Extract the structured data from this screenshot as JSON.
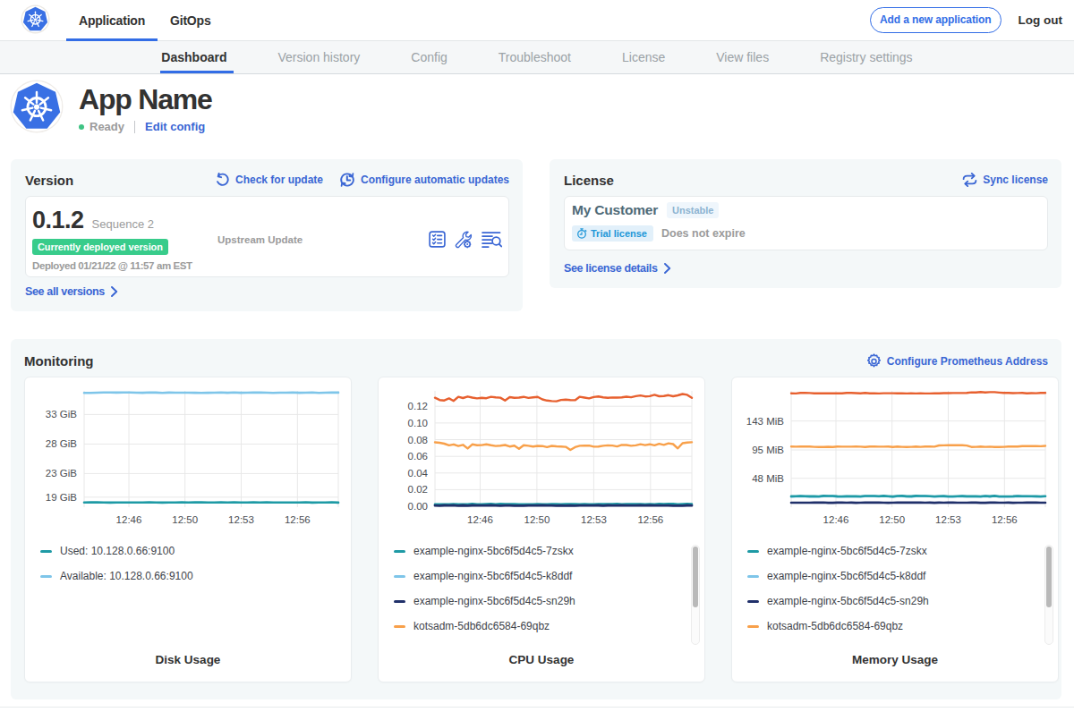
{
  "navbar": {
    "tabs": [
      "Application",
      "GitOps"
    ],
    "add_app_label": "Add a new application",
    "logout_label": "Log out"
  },
  "subnav": {
    "tabs": [
      "Dashboard",
      "Version history",
      "Config",
      "Troubleshoot",
      "License",
      "View files",
      "Registry settings"
    ],
    "active": "Dashboard"
  },
  "app": {
    "name": "App Name",
    "status": "Ready",
    "edit_config": "Edit config"
  },
  "version": {
    "title": "Version",
    "check_update": "Check for update",
    "auto_updates": "Configure automatic updates",
    "number": "0.1.2",
    "sequence": "Sequence 2",
    "deployed_badge": "Currently deployed version",
    "deployed_at": "Deployed 01/21/22 @ 11:57 am EST",
    "source": "Upstream Update",
    "see_all": "See all versions"
  },
  "license": {
    "title": "License",
    "sync": "Sync license",
    "customer": "My Customer",
    "channel": "Unstable",
    "type": "Trial license",
    "expiration": "Does not expire",
    "see_details": "See license details"
  },
  "monitoring": {
    "title": "Monitoring",
    "configure": "Configure Prometheus Address"
  },
  "colors": {
    "accent": "#326de6",
    "link": "#3a66d4",
    "green": "#38cc8b",
    "grid": "#e8e8e8",
    "teal": "#1e9aa5",
    "lightblue": "#7ec5e9",
    "navy": "#20306a",
    "orange": "#f8a04a",
    "redorange": "#e7602f"
  },
  "chart_data": [
    {
      "id": "disk",
      "type": "line",
      "title": "Disk Usage",
      "plot_left": 66,
      "x_ticks": [
        "12:46",
        "12:50",
        "12:53",
        "12:56"
      ],
      "x_tick_pos": [
        0.176,
        0.397,
        0.618,
        0.839
      ],
      "y_ticks": [
        {
          "label": "19 GiB",
          "value": 19
        },
        {
          "label": "23 GiB",
          "value": 23
        },
        {
          "label": "28 GiB",
          "value": 28
        },
        {
          "label": "33 GiB",
          "value": 33
        }
      ],
      "ylim": [
        17.3,
        37.0
      ],
      "scrollbar": false,
      "series": [
        {
          "name": "Used: 10.128.0.66:9100",
          "color": "teal",
          "width": 2.6,
          "values": [
            18.085,
            18.128,
            18.112,
            18.088,
            18.071,
            18.1,
            18.11,
            18.095,
            18.085,
            18.11,
            18.126,
            18.084,
            18.072,
            18.09,
            18.095,
            18.111,
            18.082,
            18.118,
            18.114,
            18.1,
            18.082,
            18.128,
            18.089,
            18.119,
            18.084,
            18.083,
            18.116,
            18.088,
            18.127,
            18.1,
            18.081,
            18.083,
            18.095,
            18.11,
            18.127,
            18.079,
            18.094,
            18.083,
            18.128,
            18.079
          ]
        },
        {
          "name": "Available: 10.128.0.66:9100",
          "color": "lightblue",
          "width": 2.6,
          "values": [
            36.673,
            36.674,
            36.694,
            36.724,
            36.723,
            36.714,
            36.73,
            36.726,
            36.69,
            36.681,
            36.726,
            36.715,
            36.672,
            36.71,
            36.693,
            36.692,
            36.69,
            36.68,
            36.67,
            36.687,
            36.691,
            36.727,
            36.677,
            36.728,
            36.682,
            36.691,
            36.719,
            36.719,
            36.696,
            36.673,
            36.698,
            36.692,
            36.725,
            36.682,
            36.692,
            36.724,
            36.672,
            36.695,
            36.719,
            36.716
          ]
        }
      ]
    },
    {
      "id": "cpu",
      "type": "line",
      "title": "CPU Usage",
      "plot_left": 63,
      "x_ticks": [
        "12:46",
        "12:50",
        "12:53",
        "12:56"
      ],
      "x_tick_pos": [
        0.176,
        0.397,
        0.618,
        0.839
      ],
      "y_ticks": [
        {
          "label": "0.00",
          "value": 0.0
        },
        {
          "label": "0.02",
          "value": 0.02
        },
        {
          "label": "0.04",
          "value": 0.04
        },
        {
          "label": "0.06",
          "value": 0.06
        },
        {
          "label": "0.08",
          "value": 0.08
        },
        {
          "label": "0.10",
          "value": 0.1
        },
        {
          "label": "0.12",
          "value": 0.12
        }
      ],
      "ylim": [
        -0.001,
        0.1385
      ],
      "scrollbar": true,
      "series": [
        {
          "name": "example-nginx-5bc6f5d4c5-7zskx",
          "color": "teal",
          "width": 2.6,
          "z": 2,
          "values": [
            0.00243,
            0.00245,
            0.00248,
            0.00244,
            0.00265,
            0.00246,
            0.00255,
            0.00238,
            0.00285,
            0.00251,
            0.00257,
            0.00265,
            0.00284,
            0.00255,
            0.00285,
            0.0026,
            0.00262,
            0.00261,
            0.00231,
            0.00256,
            0.00241,
            0.0023,
            0.00278,
            0.0024,
            0.00258,
            0.00274,
            0.00263,
            0.0025,
            0.00261,
            0.00263,
            0.00277,
            0.00236,
            0.00264,
            0.00245,
            0.00247,
            0.00276,
            0.0026,
            0.00264,
            0.00276,
            0.00285,
            0.00257,
            0.00267,
            0.0026,
            0.00261,
            0.00272,
            0.00257,
            0.00262,
            0.00259,
            0.00286,
            0.00272,
            0.00283,
            0.00287,
            0.00246,
            0.00264,
            0.00287,
            0.0028
          ]
        },
        {
          "name": "example-nginx-5bc6f5d4c5-k8ddf",
          "color": "lightblue",
          "width": 2.4,
          "z": 1,
          "values": [
            0.00165,
            0.00165,
            0.00178,
            0.00163,
            0.0017,
            0.00163,
            0.00187,
            0.00191,
            0.00196,
            0.00166,
            0.00189,
            0.00186,
            0.00166,
            0.00195,
            0.00199,
            0.00169,
            0.00198,
            0.00176,
            0.00179,
            0.002,
            0.00193,
            0.00166,
            0.00177,
            0.00181,
            0.00174,
            0.00168,
            0.00173,
            0.00189,
            0.00161,
            0.00182,
            0.00178,
            0.00161,
            0.00173,
            0.00185,
            0.0018,
            0.00163,
            0.00199,
            0.00192,
            0.00199,
            0.00164,
            0.00171,
            0.00162,
            0.00191,
            0.00171,
            0.00165,
            0.00177,
            0.00196,
            0.00193,
            0.0017,
            0.00166,
            0.00197,
            0.00183,
            0.00188,
            0.00164,
            0.00162,
            0.00188
          ]
        },
        {
          "name": "example-nginx-5bc6f5d4c5-sn29h",
          "color": "navy",
          "width": 2.8,
          "z": 3,
          "values": [
            0.00097,
            0.00083,
            0.00118,
            0.00105,
            0.00112,
            0.00083,
            0.00114,
            0.00083,
            0.00115,
            0.00098,
            0.00094,
            0.00102,
            0.00117,
            0.00091,
            0.00085,
            0.00101,
            0.0009,
            0.00084,
            0.00086,
            0.00082,
            0.00088,
            0.00092,
            0.00092,
            0.0011,
            0.00092,
            0.001,
            0.00087,
            0.00094,
            0.00081,
            0.0009,
            0.00081,
            0.00109,
            0.00102,
            0.00088,
            0.00099,
            0.00117,
            0.00084,
            0.00113,
            0.00097,
            0.001,
            0.00113,
            0.00096,
            0.001,
            0.00108,
            0.00119,
            0.00094,
            0.00113,
            0.00108,
            0.00105,
            0.00096,
            0.00094,
            0.00082,
            0.00085,
            0.00083,
            0.0011,
            0.0009
          ]
        },
        {
          "name": "kotsadm-5db6dc6584-69qbz",
          "color": "orange",
          "width": 2.4,
          "z": 4,
          "values": [
            0.0768,
            0.0763,
            0.0752,
            0.0732,
            0.0743,
            0.0724,
            0.0738,
            0.0694,
            0.0743,
            0.0734,
            0.0735,
            0.0743,
            0.0733,
            0.0724,
            0.0728,
            0.0736,
            0.0718,
            0.0727,
            0.069,
            0.0733,
            0.0726,
            0.0718,
            0.0725,
            0.0723,
            0.0711,
            0.0725,
            0.072,
            0.0717,
            0.0713,
            0.0676,
            0.071,
            0.0726,
            0.0727,
            0.0728,
            0.0715,
            0.0716,
            0.0726,
            0.0732,
            0.0729,
            0.0719,
            0.0737,
            0.0736,
            0.0726,
            0.0731,
            0.0745,
            0.0735,
            0.0744,
            0.0733,
            0.0751,
            0.0738,
            0.0756,
            0.0746,
            0.0695,
            0.0757,
            0.0766,
            0.0769
          ]
        },
        {
          "name": "",
          "color": "redorange",
          "width": 2.4,
          "z": 5,
          "values": [
            0.1302,
            0.1276,
            0.127,
            0.1295,
            0.1265,
            0.1314,
            0.1299,
            0.1317,
            0.1304,
            0.1295,
            0.1301,
            0.1297,
            0.1314,
            0.1308,
            0.1303,
            0.127,
            0.131,
            0.1302,
            0.1305,
            0.1313,
            0.13,
            0.1307,
            0.1312,
            0.1283,
            0.1269,
            0.1263,
            0.126,
            0.1277,
            0.128,
            0.1276,
            0.1273,
            0.1314,
            0.1305,
            0.1295,
            0.1311,
            0.1317,
            0.1308,
            0.1301,
            0.1306,
            0.1304,
            0.1308,
            0.1315,
            0.1309,
            0.1322,
            0.133,
            0.1319,
            0.1322,
            0.1338,
            0.1321,
            0.1324,
            0.1334,
            0.1321,
            0.1331,
            0.1347,
            0.1338,
            0.1301
          ]
        }
      ]
    },
    {
      "id": "memory",
      "type": "line",
      "title": "Memory Usage",
      "plot_left": 66,
      "x_ticks": [
        "12:46",
        "12:50",
        "12:53",
        "12:56"
      ],
      "x_tick_pos": [
        0.176,
        0.397,
        0.618,
        0.839
      ],
      "y_ticks": [
        {
          "label": "48 MiB",
          "value": 48
        },
        {
          "label": "95 MiB",
          "value": 95
        },
        {
          "label": "143 MiB",
          "value": 143
        }
      ],
      "ylim": [
        0,
        193
      ],
      "scrollbar": true,
      "series": [
        {
          "name": "example-nginx-5bc6f5d4c5-7zskx",
          "color": "teal",
          "width": 2.6,
          "z": 2,
          "values": [
            17.9,
            18.06,
            18.52,
            18.15,
            17.91,
            17.91,
            17.84,
            18.65,
            18.52,
            18.59,
            17.93,
            17.88,
            18.19,
            18.0,
            18.04,
            17.79,
            18.54,
            18.63,
            18.6,
            18.07,
            18.7,
            18.06,
            17.61,
            18.53,
            18.64,
            17.97,
            17.89,
            18.66,
            18.51,
            18.61,
            18.25,
            17.75,
            18.15,
            18.34,
            17.75,
            17.83,
            18.04,
            18.44,
            17.96,
            18.0,
            18.09,
            17.86,
            18.61,
            17.92,
            18.7,
            17.84,
            17.79,
            17.79,
            17.96,
            18.59,
            18.11,
            18.22,
            18.04,
            17.98,
            17.83,
            18.33
          ]
        },
        {
          "name": "example-nginx-5bc6f5d4c5-k8ddf",
          "color": "lightblue",
          "width": 2.4,
          "z": 1,
          "values": [
            17.55,
            17.71,
            18.17,
            17.8,
            17.56,
            17.56,
            17.49,
            18.3,
            18.17,
            18.24,
            17.58,
            17.53,
            17.84,
            17.65,
            17.69,
            17.44,
            18.19,
            18.28,
            18.25,
            17.72,
            18.35,
            17.71,
            17.26,
            18.18,
            18.29,
            17.62,
            17.54,
            18.31,
            18.16,
            18.26,
            17.9,
            17.4,
            17.8,
            17.99,
            17.4,
            17.48,
            17.69,
            18.09,
            17.61,
            17.65,
            17.74,
            17.51,
            18.26,
            17.57,
            18.35,
            17.49,
            17.44,
            17.44,
            17.61,
            18.24,
            17.76,
            17.87,
            17.69,
            17.63,
            17.48,
            17.98
          ]
        },
        {
          "name": "example-nginx-5bc6f5d4c5-sn29h",
          "color": "navy",
          "width": 2.6,
          "z": 3,
          "values": [
            7.39,
            7.41,
            7.4,
            7.46,
            7.48,
            7.68,
            7.64,
            7.65,
            7.31,
            7.31,
            7.58,
            7.66,
            7.49,
            7.53,
            7.3,
            7.46,
            7.67,
            7.63,
            7.64,
            7.69,
            7.4,
            7.34,
            7.36,
            7.51,
            7.57,
            7.68,
            7.59,
            7.56,
            7.61,
            7.48,
            7.52,
            7.32,
            7.61,
            7.39,
            7.67,
            7.56,
            7.42,
            7.35,
            7.4,
            7.55,
            7.58,
            7.34,
            7.33,
            7.51,
            7.53,
            7.46,
            7.39,
            7.54,
            7.3,
            7.42,
            7.48,
            7.68,
            7.56,
            7.65,
            7.49,
            7.39
          ]
        },
        {
          "name": "kotsadm-5db6dc6584-69qbz",
          "color": "orange",
          "width": 2.4,
          "z": 4,
          "values": [
            100.59,
            100.38,
            100.65,
            100.46,
            100.47,
            100.06,
            99.88,
            99.97,
            100.17,
            99.94,
            100.6,
            100.35,
            100.41,
            100.41,
            100.46,
            100.29,
            99.85,
            100.57,
            100.52,
            100.3,
            100.33,
            100.44,
            99.91,
            100.51,
            100.08,
            99.92,
            100.09,
            100.51,
            100.03,
            100.52,
            100.73,
            100.29,
            102.49,
            102.58,
            102.77,
            102.84,
            102.71,
            102.73,
            102.22,
            99.98,
            100.08,
            100.52,
            100.12,
            100.36,
            99.86,
            99.9,
            100.09,
            100.45,
            100.47,
            100.46,
            101.21,
            101.41,
            101.37,
            101.37,
            101.06,
            101.75
          ]
        },
        {
          "name": "",
          "color": "redorange",
          "width": 2.4,
          "z": 5,
          "values": [
            188.83,
            188.74,
            189.58,
            189.61,
            189.39,
            188.96,
            188.92,
            188.97,
            189.16,
            188.82,
            189.14,
            188.94,
            189.71,
            189.72,
            189.25,
            188.92,
            189.71,
            188.99,
            189.04,
            188.65,
            189.07,
            189.17,
            189.2,
            188.87,
            189.21,
            188.66,
            188.94,
            188.75,
            189.09,
            188.7,
            188.67,
            188.98,
            188.91,
            189.29,
            189.23,
            189.48,
            189.37,
            189.44,
            189.62,
            190.58,
            190.51,
            191.23,
            190.31,
            190.95,
            190.86,
            190.2,
            189.57,
            189.63,
            189.34,
            189.46,
            189.54,
            188.8,
            189.23,
            189.2,
            189.57,
            189.54
          ]
        }
      ]
    }
  ]
}
